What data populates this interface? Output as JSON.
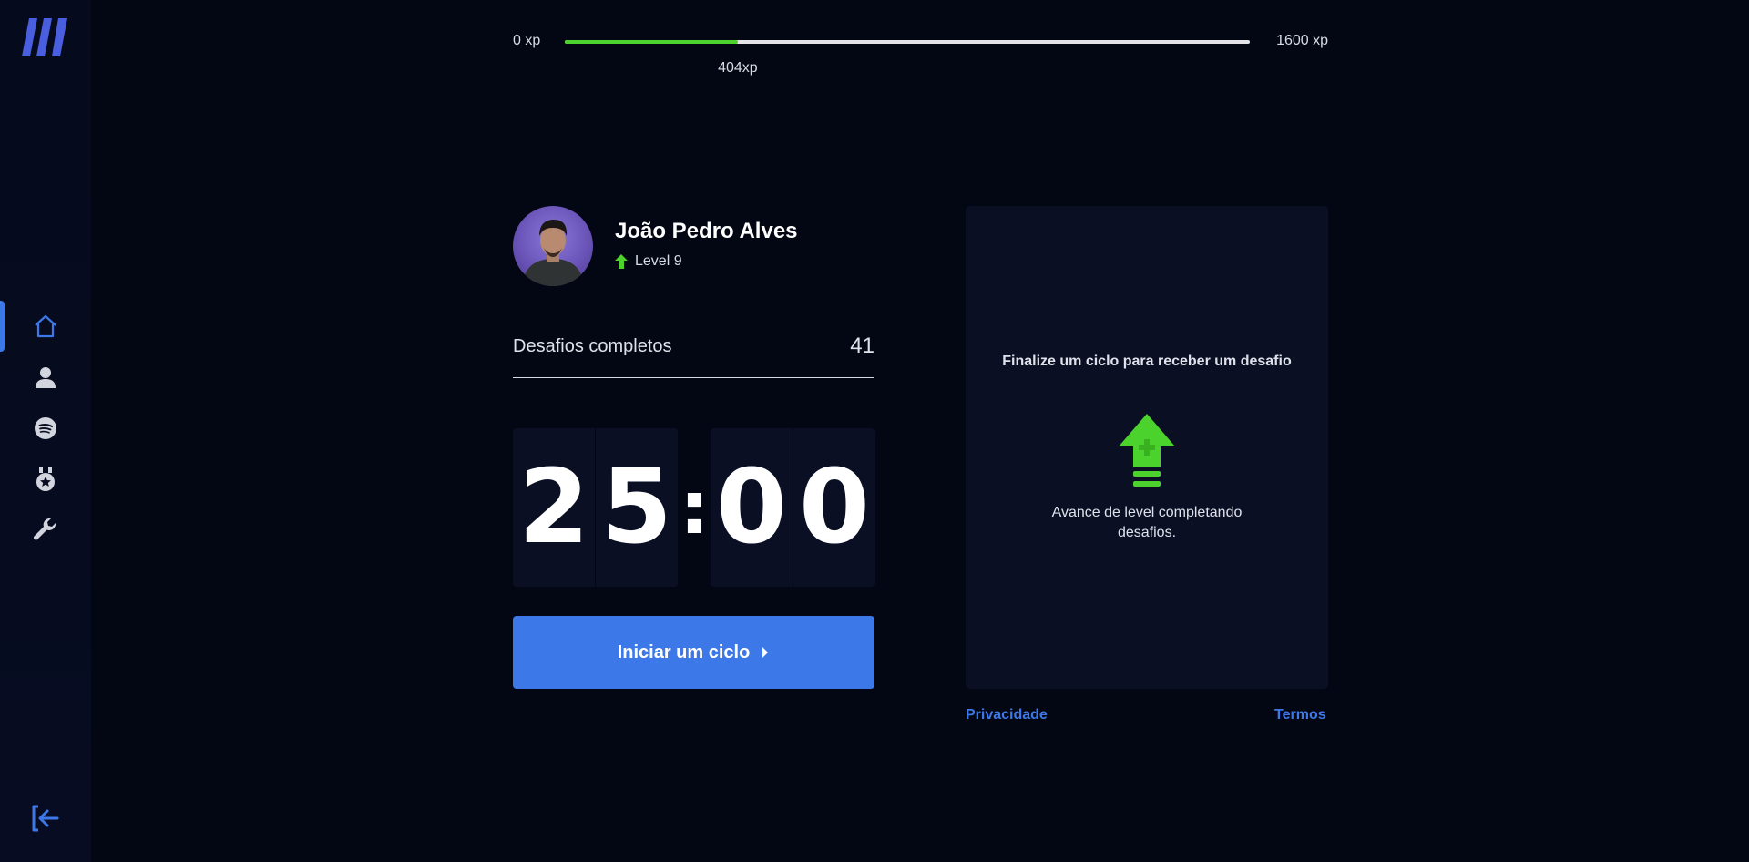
{
  "xp": {
    "min_label": "0 xp",
    "max_label": "1600 xp",
    "current_label": "404xp",
    "current": 404,
    "max": 1600
  },
  "user": {
    "name": "João Pedro Alves",
    "level": "Level 9"
  },
  "challenges": {
    "label": "Desafios completos",
    "count": "41"
  },
  "timer": {
    "m1": "2",
    "m2": "5",
    "separator": ":",
    "s1": "0",
    "s2": "0"
  },
  "start_button": {
    "label": "Iniciar um ciclo"
  },
  "challenge_panel": {
    "title": "Finalize um ciclo para receber um desafio",
    "text": "Avance de level completando desafios."
  },
  "footer": {
    "privacy": "Privacidade",
    "terms": "Termos"
  },
  "nav": {
    "active": "home",
    "items": [
      "home-icon",
      "profile-icon",
      "spotify-icon",
      "medal-icon",
      "wrench-icon"
    ]
  },
  "colors": {
    "background": "#030714",
    "accent": "#3c78e8",
    "success": "#4bd22d",
    "panel": "#0a0f24"
  }
}
